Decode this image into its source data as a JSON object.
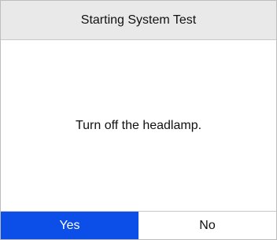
{
  "header": {
    "title": "Starting System Test"
  },
  "message": {
    "text": "Turn off the headlamp."
  },
  "buttons": {
    "yes_label": "Yes",
    "no_label": "No"
  },
  "colors": {
    "header_bg": "#e9e9e9",
    "selected_button_bg": "#0b4fe8",
    "selected_button_text": "#ffffff"
  }
}
